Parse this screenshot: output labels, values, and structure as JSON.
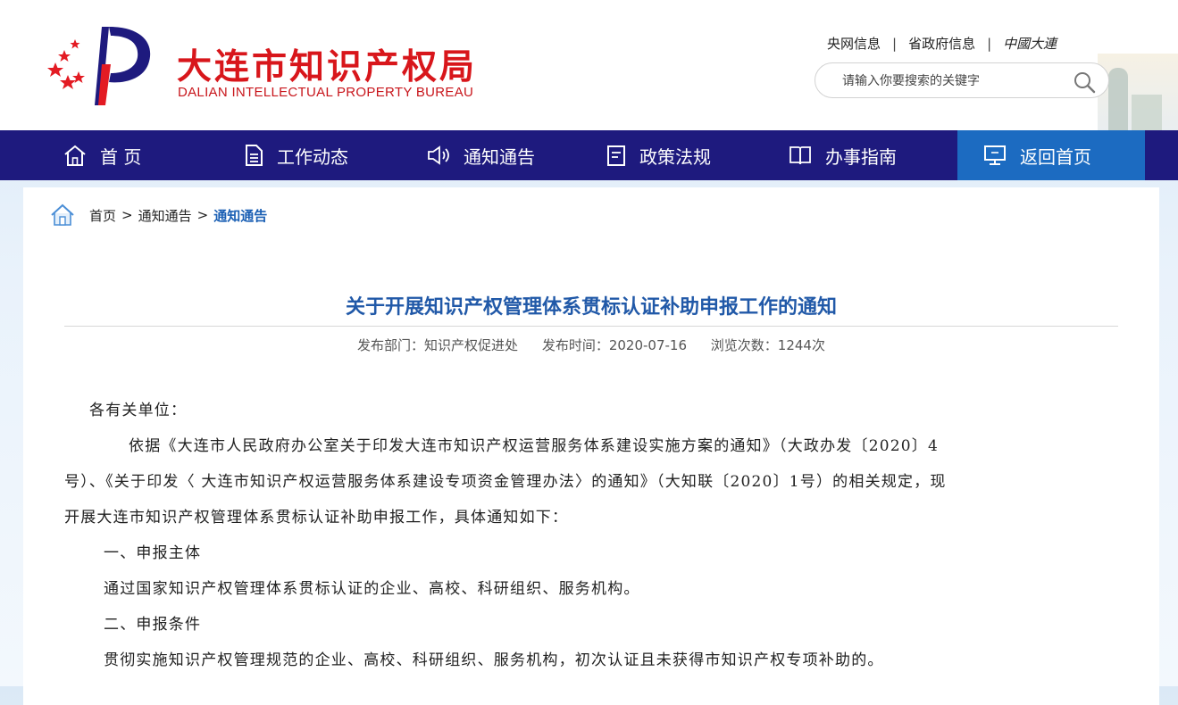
{
  "site": {
    "name_cn": "大连市知识产权局",
    "name_en": "DALIAN  INTELLECTUAL PROPERTY BUREAU"
  },
  "top_links": {
    "cctv": "央网信息",
    "province": "省政府信息",
    "china_dalian": "中國大連"
  },
  "search": {
    "placeholder": "请输入你要搜索的关键字"
  },
  "nav": {
    "items": [
      {
        "label": "首 页",
        "icon": "home-icon"
      },
      {
        "label": "工作动态",
        "icon": "document-icon"
      },
      {
        "label": "通知通告",
        "icon": "speaker-icon"
      },
      {
        "label": "政策法规",
        "icon": "clipboard-icon"
      },
      {
        "label": "办事指南",
        "icon": "book-icon"
      },
      {
        "label": "返回首页",
        "icon": "monitor-icon",
        "active": true
      }
    ]
  },
  "breadcrumb": {
    "home": "首页",
    "level1": "通知通告",
    "current": "通知通告",
    "separator": ">"
  },
  "article": {
    "title": "关于开展知识产权管理体系贯标认证补助申报工作的通知",
    "meta": {
      "department": "发布部门：知识产权促进处",
      "date": "发布时间：2020-07-16",
      "views": "浏览次数：1244次"
    },
    "lines": [
      "各有关单位：",
      "依据《大连市人民政府办公室关于印发大连市知识产权运营服务体系建设实施方案的通知》（大政办发〔2020〕4",
      "号）、《关于印发〈 大连市知识产权运营服务体系建设专项资金管理办法〉的通知》（大知联〔2020〕1号）的相关规定，现",
      "开展大连市知识产权管理体系贯标认证补助申报工作，具体通知如下：",
      "一、申报主体",
      "通过国家知识产权管理体系贯标认证的企业、高校、科研组织、服务机构。",
      "二、申报条件",
      "贯彻实施知识产权管理规范的企业、高校、科研组织、服务机构，初次认证且未获得市知识产权专项补助的。"
    ]
  },
  "colors": {
    "brand_red": "#d8161b",
    "nav_bg": "#1e1a7e",
    "nav_active": "#1c6bc1",
    "title_blue": "#2159a8"
  }
}
